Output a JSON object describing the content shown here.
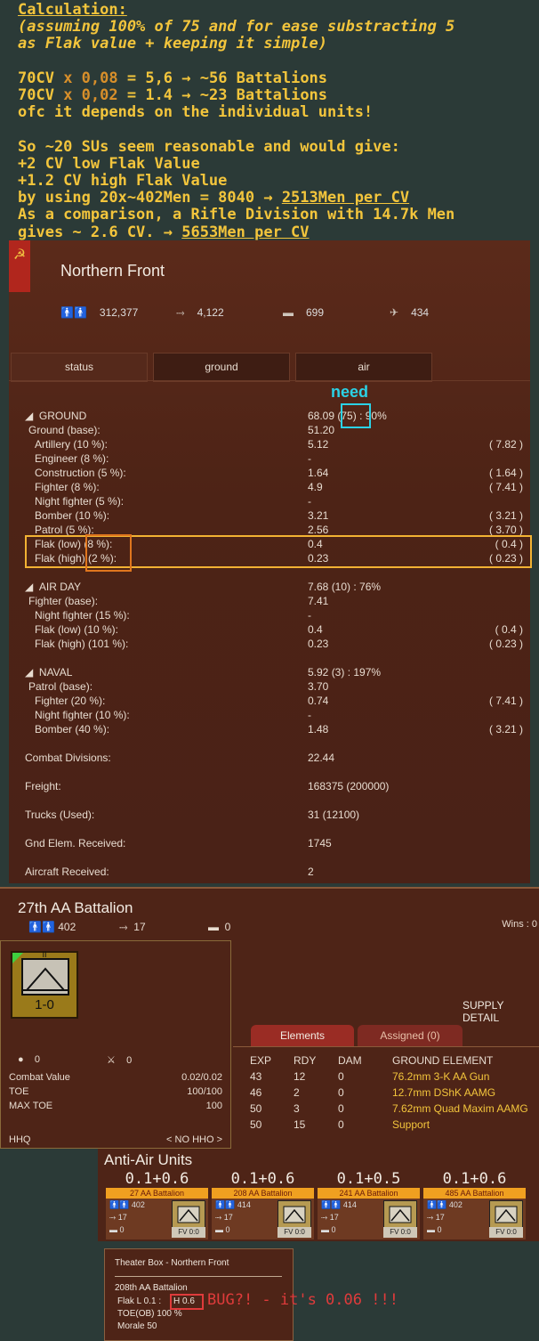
{
  "notes": {
    "heading": "Calculation:",
    "assume1": "(assuming 100% of 75 and for ease substracting 5",
    "assume2": "as Flak value + keeping it simple)",
    "l1a": "70CV ",
    "l1x": "x",
    "l1b": " 0,08",
    "l1c": " = 5,6 → ~56 Battalions",
    "l2a": "70CV ",
    "l2x": "x",
    "l2b": " 0,02",
    "l2c": " = 1.4 → ~23 Battalions",
    "l3": "ofc it depends on the individual units!",
    "l4": "So ~20 SUs seem reasonable and would give:",
    "l5": "+2 CV low Flak Value",
    "l6": "+1.2 CV high Flak Value",
    "l7a": "by using 20x~402Men = 8040 → ",
    "l7b": "2513Men per CV",
    "l8": "As a comparison, a Rifle Division with 14.7k Men",
    "l9a": "gives ~ 2.6 CV. → ",
    "l9b": "5653Men per CV"
  },
  "front": {
    "flag": "☭",
    "title": "Northern Front",
    "stats": [
      {
        "icon": "men-icon",
        "glyph": "🚹🚹",
        "value": "312,377"
      },
      {
        "icon": "gun-icon",
        "glyph": "⤑",
        "value": "4,122"
      },
      {
        "icon": "tank-icon",
        "glyph": "▬",
        "value": "699"
      },
      {
        "icon": "plane-icon",
        "glyph": "✈",
        "value": "434"
      }
    ],
    "tabs": [
      "status",
      "ground",
      "air"
    ],
    "need": "need",
    "ground": {
      "header": "GROUND",
      "value": "68.09",
      "req": "(75)",
      "pct": ": 90%",
      "rows": [
        {
          "label": "Ground (base):",
          "value": "51.20",
          "extra": "",
          "indent": 0
        },
        {
          "label": "Artillery (10 %):",
          "value": "5.12",
          "extra": "( 7.82 )",
          "indent": 1
        },
        {
          "label": "Engineer (8 %):",
          "value": "-",
          "extra": "",
          "indent": 1
        },
        {
          "label": "Construction (5 %):",
          "value": "1.64",
          "extra": "( 1.64 )",
          "indent": 1
        },
        {
          "label": "Fighter (8 %):",
          "value": "4.9",
          "extra": "( 7.41 )",
          "indent": 1
        },
        {
          "label": "Night fighter (5 %):",
          "value": "-",
          "extra": "",
          "indent": 1
        },
        {
          "label": "Bomber (10 %):",
          "value": "3.21",
          "extra": "( 3.21 )",
          "indent": 1
        },
        {
          "label": "Patrol (5 %):",
          "value": "2.56",
          "extra": "( 3.70 )",
          "indent": 1
        },
        {
          "label": "Flak (low) (8 %):",
          "value": "0.4",
          "extra": "( 0.4 )",
          "indent": 1
        },
        {
          "label": "Flak (high) (2 %):",
          "value": "0.23",
          "extra": "( 0.23 )",
          "indent": 1
        }
      ]
    },
    "airday": {
      "header": "AIR DAY",
      "value": "7.68 (10) : 76%",
      "rows": [
        {
          "label": "Fighter (base):",
          "value": "7.41",
          "extra": "",
          "indent": 0
        },
        {
          "label": "Night fighter (15 %):",
          "value": "-",
          "extra": "",
          "indent": 1
        },
        {
          "label": "Flak (low) (10 %):",
          "value": "0.4",
          "extra": "( 0.4 )",
          "indent": 1
        },
        {
          "label": "Flak (high) (101 %):",
          "value": "0.23",
          "extra": "( 0.23 )",
          "indent": 1
        }
      ]
    },
    "naval": {
      "header": "NAVAL",
      "value": "5.92 (3) : 197%",
      "rows": [
        {
          "label": "Patrol (base):",
          "value": "3.70",
          "extra": "",
          "indent": 0
        },
        {
          "label": "Fighter (20 %):",
          "value": "0.74",
          "extra": "( 7.41 )",
          "indent": 1
        },
        {
          "label": "Night fighter (10 %):",
          "value": "-",
          "extra": "",
          "indent": 1
        },
        {
          "label": "Bomber (40 %):",
          "value": "1.48",
          "extra": "( 3.21 )",
          "indent": 1
        }
      ]
    },
    "summary": [
      {
        "label": "Combat Divisions:",
        "value": "22.44"
      },
      {
        "label": "Freight:",
        "value": "168375 (200000)"
      },
      {
        "label": "Trucks (Used):",
        "value": "31 (12100)"
      },
      {
        "label": "Gnd Elem. Received:",
        "value": "1745"
      },
      {
        "label": "Aircraft Received:",
        "value": "2"
      }
    ]
  },
  "battalion": {
    "title": "27th AA Battalion",
    "men": "402",
    "guns": "17",
    "tanks": "0",
    "wins": "Wins : 0",
    "counter_size": "II",
    "counter_value": "1-0",
    "supply": "SUPPLY DETAIL",
    "exp_icon": "●",
    "exp_val": "0",
    "kill_icon": "⚔",
    "kill_val": "0",
    "fields": [
      {
        "label": "Combat Value",
        "value": "0.02/0.02"
      },
      {
        "label": "TOE",
        "value": "100/100"
      },
      {
        "label": "MAX TOE",
        "value": "100"
      },
      {
        "label": "HHQ",
        "value": "< NO HHO >"
      }
    ],
    "tabs": [
      "Elements",
      "Assigned (0)"
    ],
    "columns": [
      "EXP",
      "RDY",
      "DAM",
      "GROUND ELEMENT"
    ],
    "elements": [
      {
        "exp": "43",
        "rdy": "12",
        "dam": "0",
        "name": "76.2mm 3-K AA Gun"
      },
      {
        "exp": "46",
        "rdy": "2",
        "dam": "0",
        "name": "12.7mm DShK AAMG"
      },
      {
        "exp": "50",
        "rdy": "3",
        "dam": "0",
        "name": "7.62mm Quad Maxim AAMG"
      },
      {
        "exp": "50",
        "rdy": "15",
        "dam": "0",
        "name": "Support"
      }
    ]
  },
  "aa": {
    "title": "Anti-Air Units",
    "units": [
      {
        "val": "0.1+0.6",
        "name": "27 AA Battalion",
        "men": "402",
        "guns": "17",
        "tanks": "0",
        "fv": "FV 0:0"
      },
      {
        "val": "0.1+0.6",
        "name": "208 AA Battalion",
        "men": "414",
        "guns": "17",
        "tanks": "0",
        "fv": "FV 0:0"
      },
      {
        "val": "0.1+0.5",
        "name": "241 AA Battalion",
        "men": "414",
        "guns": "17",
        "tanks": "0",
        "fv": "FV 0:0"
      },
      {
        "val": "0.1+0.6",
        "name": "485 AA Battalion",
        "men": "402",
        "guns": "17",
        "tanks": "0",
        "fv": "FV 0:0"
      }
    ]
  },
  "theater": {
    "title": "Theater Box - Northern Front",
    "unit": "208th AA Battalion",
    "flak_low": "Flak  L 0.1 :",
    "flak_high": "H 0.6",
    "toe": "TOE(OB) 100 %",
    "morale": "Morale 50",
    "bug": "BUG?! - it's 0.06 !!!"
  },
  "colors": {
    "annotation": "#f3c53c",
    "need_cyan": "#2bd2e6",
    "highlight_yellow": "#f2b233",
    "highlight_orange": "#e0761e",
    "bug_red": "#e03b3b",
    "panel_bg": "#4e2417",
    "page_bg": "#2b3a37"
  }
}
